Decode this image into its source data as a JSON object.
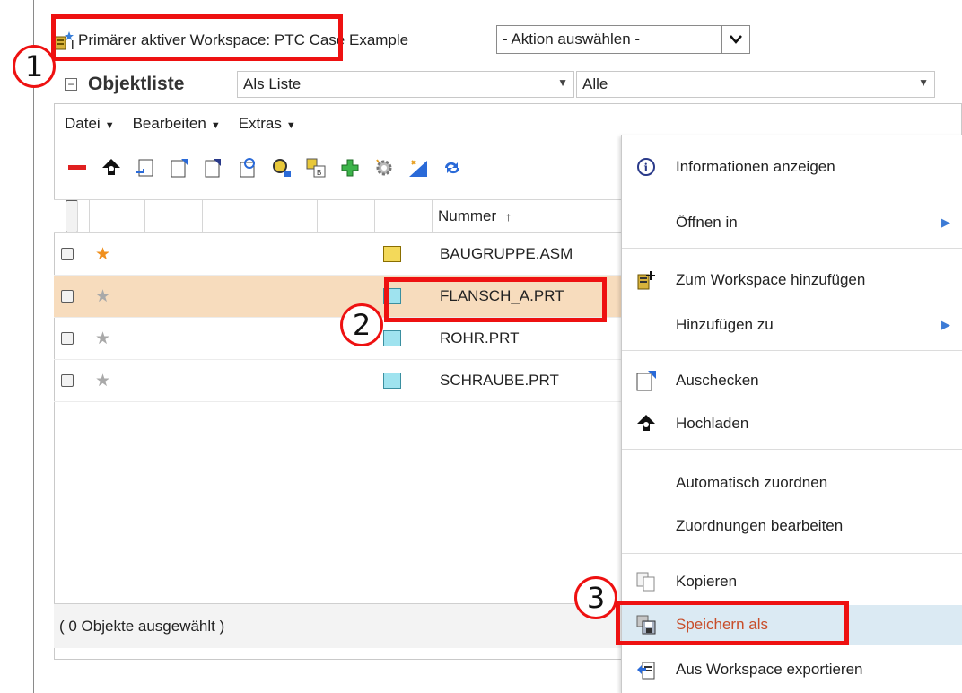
{
  "workspace": {
    "label": "Primärer aktiver Workspace: PTC Case Example",
    "action_select": "- Aktion auswählen -"
  },
  "objectlist": {
    "title": "Objektliste",
    "view_combo": "Als Liste",
    "filter_combo": "Alle"
  },
  "menubar": {
    "items": [
      "Datei",
      "Bearbeiten",
      "Extras"
    ]
  },
  "grid": {
    "column_number": "Nummer",
    "sort_indicator": "↑",
    "rows": [
      {
        "name": "BAUGRUPPE.ASM",
        "favorite": true,
        "type": "asm"
      },
      {
        "name": "FLANSCH_A.PRT",
        "favorite": false,
        "type": "prt",
        "selected": true
      },
      {
        "name": "ROHR.PRT",
        "favorite": false,
        "type": "prt"
      },
      {
        "name": "SCHRAUBE.PRT",
        "favorite": false,
        "type": "prt"
      }
    ]
  },
  "status": "( 0 Objekte ausgewählt )",
  "context_menu": {
    "items": [
      {
        "label": "Informationen anzeigen",
        "icon": "info-icon"
      },
      {
        "label": "Öffnen in",
        "icon": "",
        "submenu": true
      },
      {
        "label": "Zum Workspace hinzufügen",
        "icon": "add-to-workspace-icon"
      },
      {
        "label": "Hinzufügen zu",
        "icon": "",
        "submenu": true
      },
      {
        "label": "Auschecken",
        "icon": "checkout-icon"
      },
      {
        "label": "Hochladen",
        "icon": "upload-icon"
      },
      {
        "label": "Automatisch zuordnen",
        "icon": ""
      },
      {
        "label": "Zuordnungen bearbeiten",
        "icon": ""
      },
      {
        "label": "Kopieren",
        "icon": "copy-icon"
      },
      {
        "label": "Speichern als",
        "icon": "save-as-icon",
        "highlighted": true
      },
      {
        "label": "Aus Workspace exportieren",
        "icon": "export-icon"
      }
    ]
  },
  "annotations": [
    "1",
    "2",
    "3"
  ],
  "colors": {
    "highlight_box": "#e11111",
    "selected_row": "#f7dcbd",
    "menu_hover": "#dbeaf3"
  }
}
